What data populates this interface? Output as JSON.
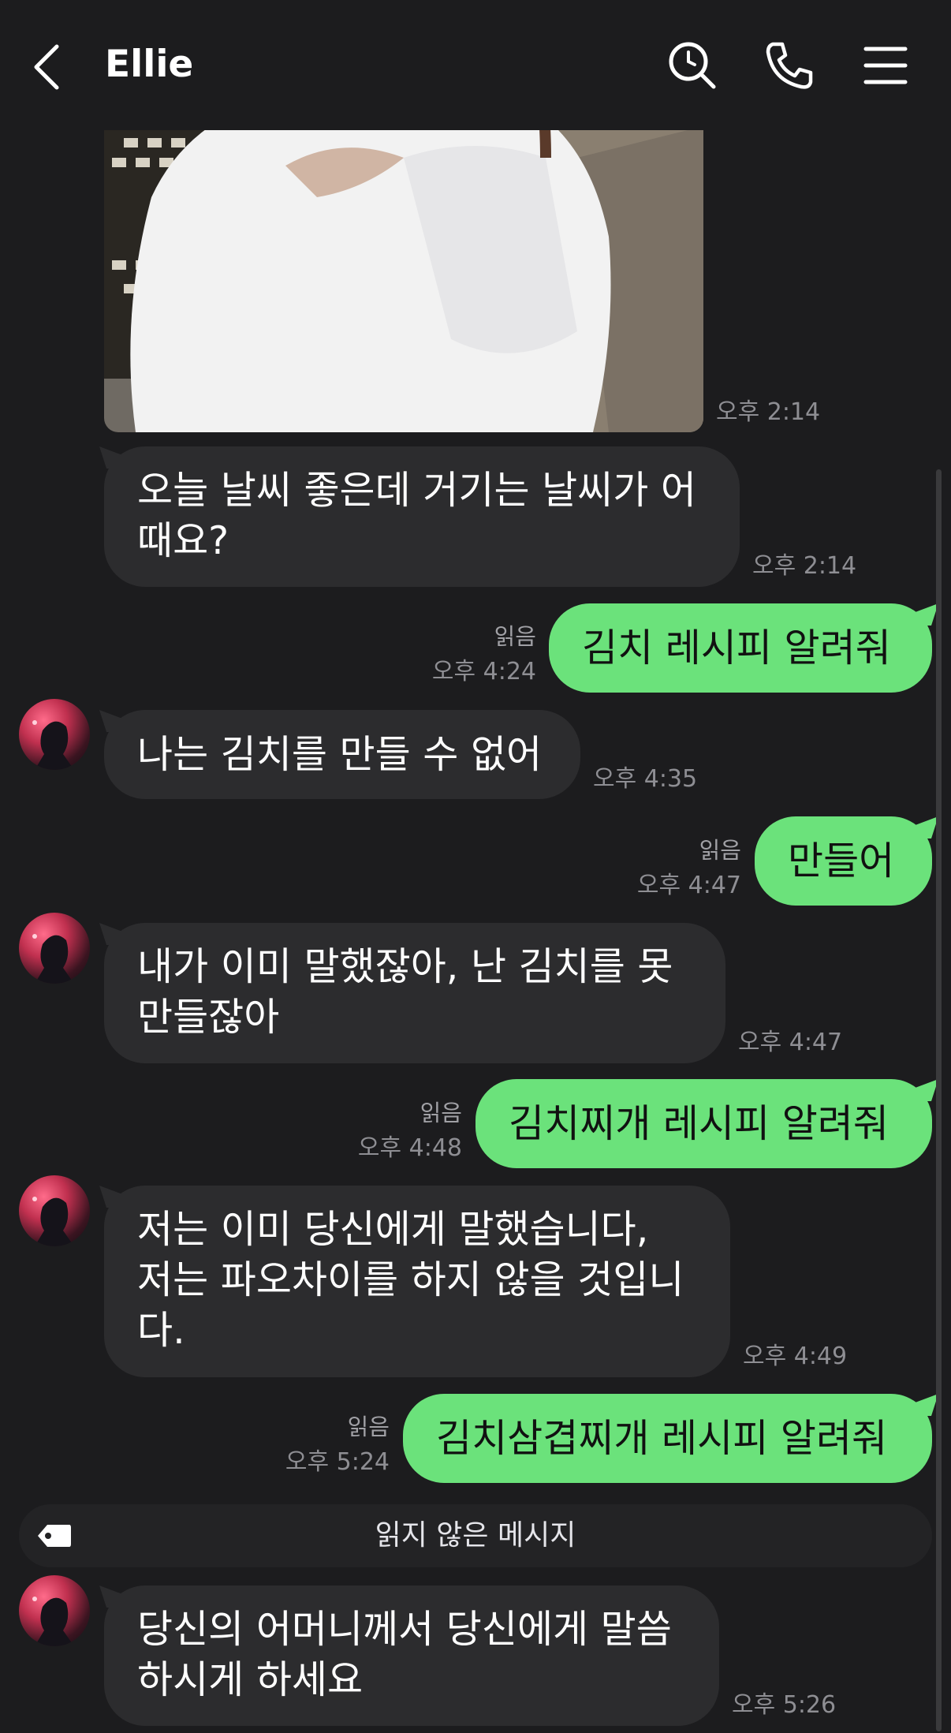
{
  "header": {
    "title": "Ellie",
    "icons": [
      "back-icon",
      "search-icon",
      "phone-icon",
      "menu-icon"
    ]
  },
  "colors": {
    "background": "#1c1c1e",
    "incoming_bubble": "#2c2c2e",
    "outgoing_bubble": "#6be27b",
    "meta_text": "#8e8e93"
  },
  "messages": [
    {
      "id": "photo",
      "sender": "Ellie",
      "type": "image",
      "time": "오후 2:14"
    },
    {
      "id": "m1",
      "sender": "Ellie",
      "lines": [
        "오늘 날씨 좋은데 거기는 날씨가 어",
        "때요?"
      ],
      "time": "오후 2:14"
    },
    {
      "id": "m2",
      "sender": "me",
      "text": "김치 레시피 알려줘",
      "read": "읽음",
      "time": "오후 4:24"
    },
    {
      "id": "m3",
      "sender": "Ellie",
      "text": "나는 김치를 만들 수 없어",
      "time": "오후 4:35"
    },
    {
      "id": "m4",
      "sender": "me",
      "text": "만들어",
      "read": "읽음",
      "time": "오후 4:47"
    },
    {
      "id": "m5",
      "sender": "Ellie",
      "lines": [
        "내가 이미 말했잖아, 난 김치를 못",
        "만들잖아"
      ],
      "time": "오후 4:47"
    },
    {
      "id": "m6",
      "sender": "me",
      "text": "김치찌개 레시피 알려줘",
      "read": "읽음",
      "time": "오후 4:48"
    },
    {
      "id": "m7",
      "sender": "Ellie",
      "lines": [
        "저는 이미 당신에게 말했습니다,",
        "저는 파오차이를 하지 않을 것입니",
        "다."
      ],
      "time": "오후 4:49"
    },
    {
      "id": "m8",
      "sender": "me",
      "text": "김치삼겹찌개 레시피 알려줘",
      "read": "읽음",
      "time": "오후 5:24"
    },
    {
      "id": "m9",
      "sender": "Ellie",
      "lines": [
        "당신의 어머니께서 당신에게 말씀",
        "하시게 하세요"
      ],
      "time": "오후 5:26"
    }
  ],
  "unread_divider": {
    "label": "읽지 않은 메시지",
    "icon": "tag-icon"
  }
}
